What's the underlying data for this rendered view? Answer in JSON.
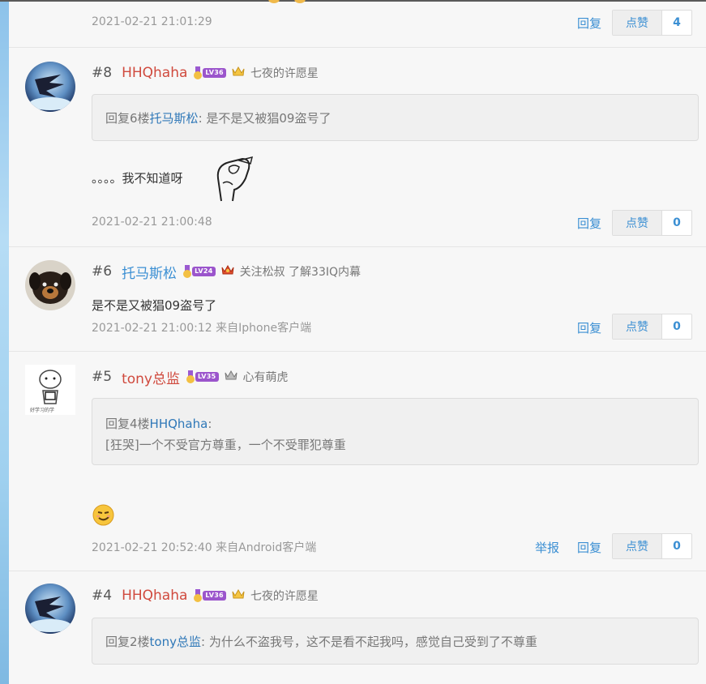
{
  "actions": {
    "reply": "回复",
    "like": "点赞",
    "report": "举报"
  },
  "top_post": {
    "timestamp": "2021-02-21 21:01:29",
    "likes": "4"
  },
  "posts": [
    {
      "floor": "#8",
      "username": "HHQhaha",
      "level": "LV36",
      "user_title": "七夜的许愿星",
      "quote_prefix": "回复6楼",
      "quote_user": "托马斯松",
      "quote_text": ": 是不是又被猖09盗号了",
      "content": "。。。。我不知道呀",
      "timestamp": "2021-02-21 21:00:48",
      "likes": "0"
    },
    {
      "floor": "#6",
      "username": "托马斯松",
      "level": "LV24",
      "user_title": "关注松叔 了解33IQ内幕",
      "content": "是不是又被猖09盗号了",
      "timestamp": "2021-02-21 21:00:12 来自Iphone客户端",
      "likes": "0"
    },
    {
      "floor": "#5",
      "username": "tony总监",
      "level": "LV35",
      "user_title": "心有萌虎",
      "quote_prefix": "回复4楼",
      "quote_user": "HHQhaha",
      "quote_text": ":",
      "quote_line2": "[狂哭]一个不受官方尊重，一个不受罪犯尊重",
      "avatar_caption": "好学习的学",
      "timestamp": "2021-02-21 20:52:40 来自Android客户端",
      "likes": "0"
    },
    {
      "floor": "#4",
      "username": "HHQhaha",
      "level": "LV36",
      "user_title": "七夜的许愿星",
      "quote_prefix": "回复2楼",
      "quote_user": "tony总监",
      "quote_text": ": 为什么不盗我号，这不是看不起我吗，感觉自己受到了不尊重"
    }
  ],
  "colors": {
    "username_red": "#d04a3e",
    "username_blue": "#3b8fd3",
    "link": "#3b8fd3",
    "level_badge": "#9b55cc"
  }
}
